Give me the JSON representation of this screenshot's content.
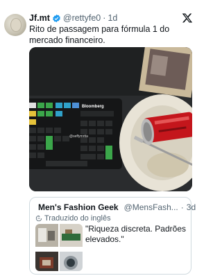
{
  "tweet": {
    "display_name": "Jf.mt",
    "handle": "@rettyfe0",
    "separator": "·",
    "age": "1d",
    "text": "Rito de passagem para fórmula 1 do mercado financeiro."
  },
  "media": {
    "keyboard_brand": "Bloomberg",
    "watermark": "@seffymrtta"
  },
  "quote": {
    "display_name": "Men's Fashion Geek",
    "handle": "@MensFash...",
    "separator": "·",
    "age": "3d",
    "translated_label": "Traduzido do inglês",
    "text": "\"Riqueza discreta. Padrões elevados.\""
  },
  "colors": {
    "verified_blue": "#1d9bf0",
    "text_primary": "#0f1419",
    "text_secondary": "#536471"
  },
  "icons": [
    "verified-badge-icon",
    "x-logo-icon",
    "translate-icon"
  ]
}
